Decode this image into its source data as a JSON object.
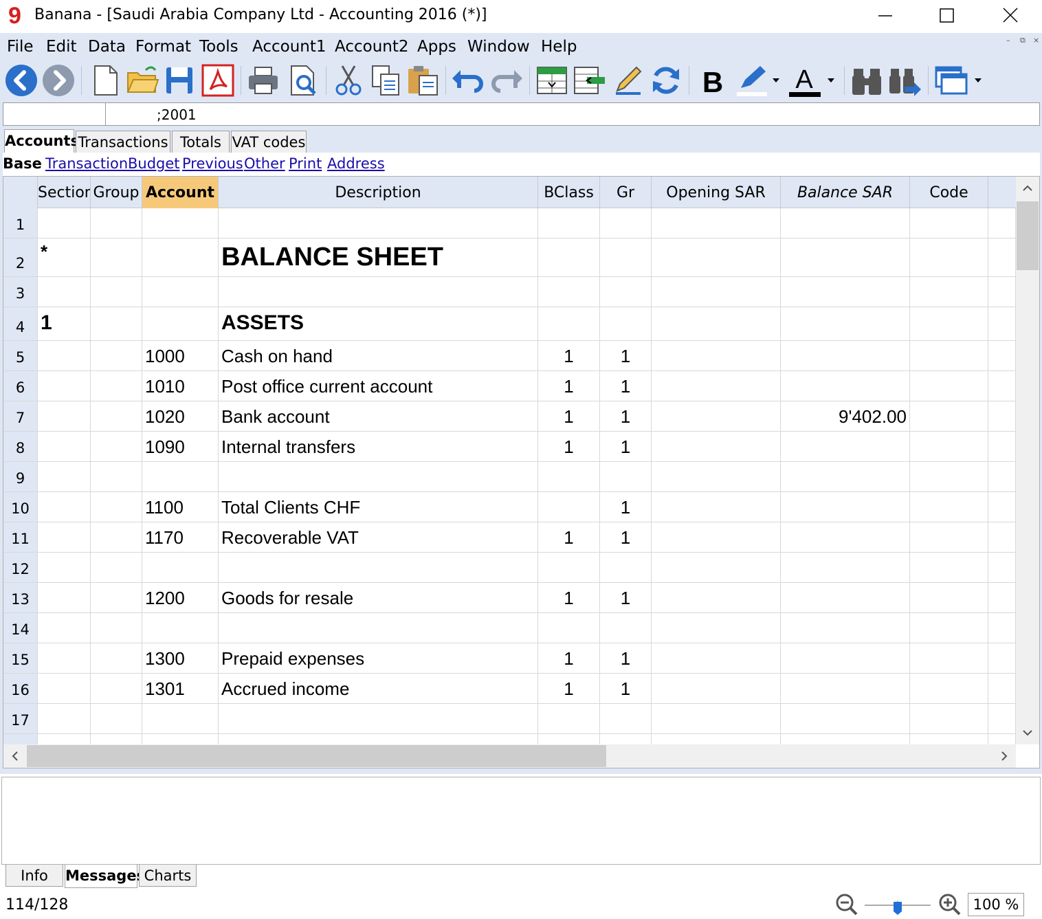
{
  "window": {
    "logo": "9",
    "title": "Banana - [Saudi Arabia Company Ltd - Accounting 2016 (*)]"
  },
  "menu": [
    "File",
    "Edit",
    "Data",
    "Format",
    "Tools",
    "Account1",
    "Account2",
    "Apps",
    "Window",
    "Help"
  ],
  "toolbar": {
    "icons": [
      "back-icon",
      "forward-icon",
      "new-file-icon",
      "open-folder-icon",
      "save-icon",
      "pdf-icon",
      "print-icon",
      "print-preview-icon",
      "cut-icon",
      "copy-icon",
      "paste-icon",
      "undo-icon",
      "redo-icon",
      "insert-rows-icon",
      "delete-rows-icon",
      "edit-icon",
      "recalculate-icon",
      "bold-icon",
      "highlight-icon",
      "font-color-icon",
      "find-icon",
      "find-replace-icon",
      "window-menu-icon"
    ],
    "bold_label": "B",
    "fontcolor_label": "A"
  },
  "formula_bar": {
    "cell_ref": "",
    "content": ";2001"
  },
  "tabs": [
    "Accounts",
    "Transactions",
    "Totals",
    "VAT codes"
  ],
  "views": [
    "Base",
    "Transaction",
    "Budget",
    "Previous",
    "Other",
    "Print",
    "Address"
  ],
  "columns": [
    "Section",
    "Group",
    "Account",
    "Description",
    "BClass",
    "Gr",
    "Opening SAR",
    "Balance SAR",
    "Code"
  ],
  "rows": [
    {
      "n": "1",
      "section": "",
      "group": "",
      "account": "",
      "description": "",
      "bclass": "",
      "gr": "",
      "opening": "",
      "balance": "",
      "code": ""
    },
    {
      "n": "2",
      "section": "*",
      "group": "",
      "account": "",
      "description": "BALANCE SHEET",
      "bclass": "",
      "gr": "",
      "opening": "",
      "balance": "",
      "code": ""
    },
    {
      "n": "3",
      "section": "",
      "group": "",
      "account": "",
      "description": "",
      "bclass": "",
      "gr": "",
      "opening": "",
      "balance": "",
      "code": ""
    },
    {
      "n": "4",
      "section": "1",
      "group": "",
      "account": "",
      "description": "ASSETS",
      "bclass": "",
      "gr": "",
      "opening": "",
      "balance": "",
      "code": ""
    },
    {
      "n": "5",
      "section": "",
      "group": "",
      "account": "1000",
      "description": "Cash on hand",
      "bclass": "1",
      "gr": "1",
      "opening": "",
      "balance": "",
      "code": ""
    },
    {
      "n": "6",
      "section": "",
      "group": "",
      "account": "1010",
      "description": "Post office current account",
      "bclass": "1",
      "gr": "1",
      "opening": "",
      "balance": "",
      "code": ""
    },
    {
      "n": "7",
      "section": "",
      "group": "",
      "account": "1020",
      "description": "Bank account",
      "bclass": "1",
      "gr": "1",
      "opening": "",
      "balance": "9'402.00",
      "code": ""
    },
    {
      "n": "8",
      "section": "",
      "group": "",
      "account": "1090",
      "description": "Internal transfers",
      "bclass": "1",
      "gr": "1",
      "opening": "",
      "balance": "",
      "code": ""
    },
    {
      "n": "9",
      "section": "",
      "group": "",
      "account": "",
      "description": "",
      "bclass": "",
      "gr": "",
      "opening": "",
      "balance": "",
      "code": ""
    },
    {
      "n": "10",
      "section": "",
      "group": "",
      "account": "1100",
      "description": "Total Clients CHF",
      "bclass": "",
      "gr": "1",
      "opening": "",
      "balance": "",
      "code": ""
    },
    {
      "n": "11",
      "section": "",
      "group": "",
      "account": "1170",
      "description": "Recoverable VAT",
      "bclass": "1",
      "gr": "1",
      "opening": "",
      "balance": "",
      "code": ""
    },
    {
      "n": "12",
      "section": "",
      "group": "",
      "account": "",
      "description": "",
      "bclass": "",
      "gr": "",
      "opening": "",
      "balance": "",
      "code": ""
    },
    {
      "n": "13",
      "section": "",
      "group": "",
      "account": "1200",
      "description": "Goods for resale",
      "bclass": "1",
      "gr": "1",
      "opening": "",
      "balance": "",
      "code": ""
    },
    {
      "n": "14",
      "section": "",
      "group": "",
      "account": "",
      "description": "",
      "bclass": "",
      "gr": "",
      "opening": "",
      "balance": "",
      "code": ""
    },
    {
      "n": "15",
      "section": "",
      "group": "",
      "account": "1300",
      "description": "Prepaid expenses",
      "bclass": "1",
      "gr": "1",
      "opening": "",
      "balance": "",
      "code": ""
    },
    {
      "n": "16",
      "section": "",
      "group": "",
      "account": "1301",
      "description": "Accrued income",
      "bclass": "1",
      "gr": "1",
      "opening": "",
      "balance": "",
      "code": ""
    },
    {
      "n": "17",
      "section": "",
      "group": "",
      "account": "",
      "description": "",
      "bclass": "",
      "gr": "",
      "opening": "",
      "balance": "",
      "code": ""
    }
  ],
  "bottom_tabs": [
    "Info",
    "Messages",
    "Charts"
  ],
  "status": {
    "count": "114/128",
    "zoom": "100 %",
    "zoom_level": 100
  }
}
